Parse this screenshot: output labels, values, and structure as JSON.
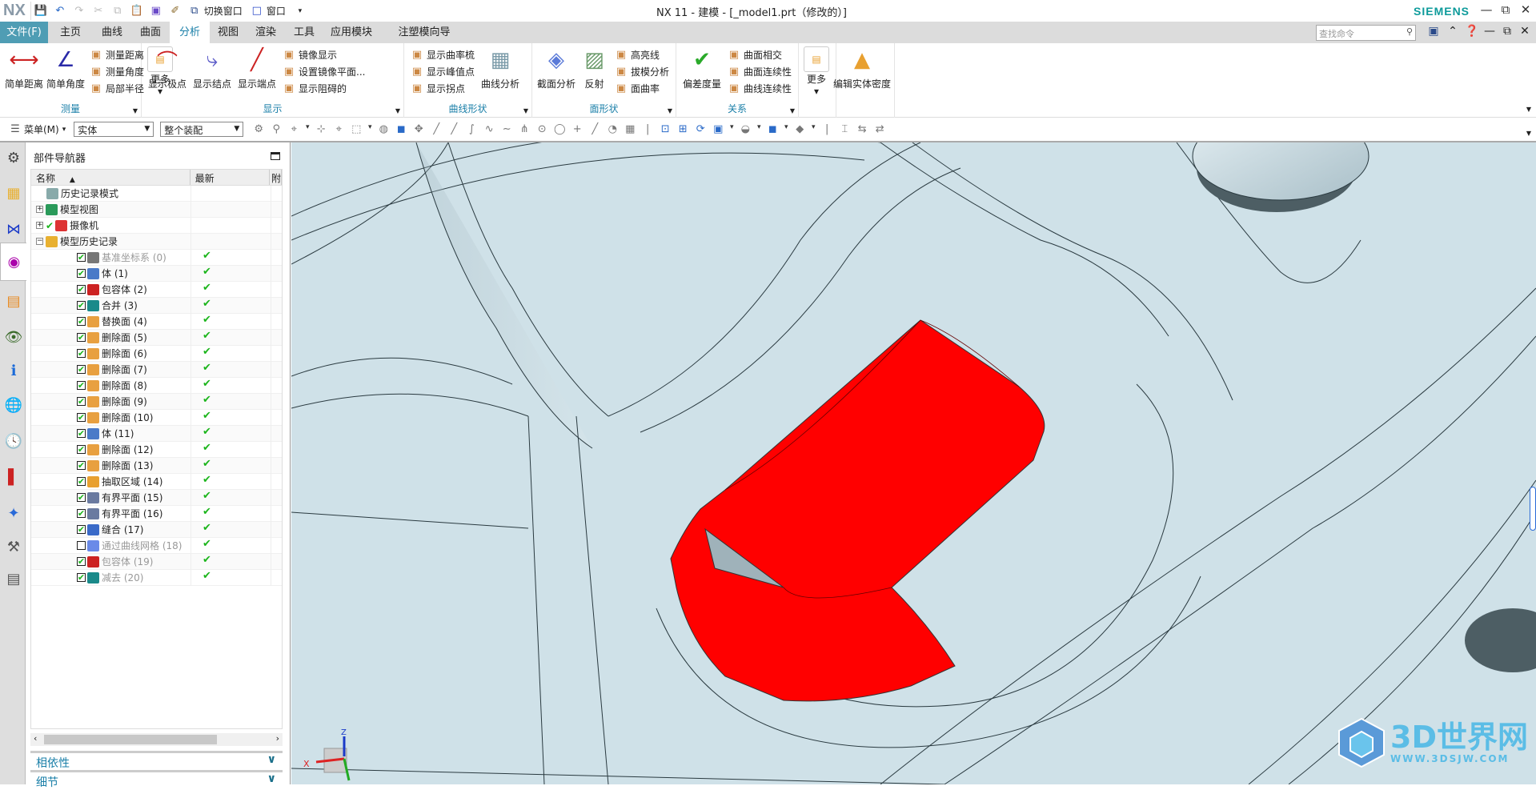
{
  "titlebar": {
    "logo": "NX",
    "switch_window": "切换窗口",
    "window_menu": "窗口",
    "title": "NX 11 - 建模 - [_model1.prt（修改的）]",
    "brand": "SIEMENS"
  },
  "tabs": [
    {
      "label": "文件(F)"
    },
    {
      "label": "主页"
    },
    {
      "label": "曲线"
    },
    {
      "label": "曲面"
    },
    {
      "label": "分析",
      "active": true
    },
    {
      "label": "视图"
    },
    {
      "label": "渲染"
    },
    {
      "label": "工具"
    },
    {
      "label": "应用模块"
    },
    {
      "label": "注塑模向导"
    }
  ],
  "search": {
    "placeholder": "查找命令"
  },
  "ribbon": {
    "groups": [
      {
        "label": "测量",
        "big": [
          {
            "label": "简单距离",
            "icon": "distance-icon"
          },
          {
            "label": "简单角度",
            "icon": "angle-icon"
          }
        ],
        "small": [
          [
            "测量距离",
            "测量角度",
            "局部半径"
          ]
        ],
        "more": "更多"
      },
      {
        "label": "显示",
        "big": [
          {
            "label": "显示极点",
            "icon": "poles-icon"
          },
          {
            "label": "显示结点",
            "icon": "knots-icon"
          },
          {
            "label": "显示端点",
            "icon": "endpoints-icon"
          }
        ],
        "small": [
          [
            "镜像显示",
            "设置镜像平面...",
            "显示阻碍的"
          ]
        ]
      },
      {
        "label": "曲线形状",
        "small": [
          [
            "显示曲率梳",
            "显示峰值点",
            "显示拐点"
          ]
        ],
        "big_after": [
          {
            "label": "曲线分析",
            "icon": "curve-analysis-icon"
          }
        ]
      },
      {
        "label": "面形状",
        "big": [
          {
            "label": "截面分析",
            "icon": "section-analysis-icon"
          },
          {
            "label": "反射",
            "icon": "reflection-icon"
          }
        ],
        "small": [
          [
            "高亮线",
            "拔模分析",
            "面曲率"
          ]
        ]
      },
      {
        "label": "关系",
        "big": [
          {
            "label": "偏差度量",
            "icon": "deviation-icon"
          }
        ],
        "small": [
          [
            "曲面相交",
            "曲面连续性",
            "曲线连续性"
          ]
        ]
      },
      {
        "label": "",
        "more": "更多"
      },
      {
        "label": "",
        "big": [
          {
            "label": "编辑实体密度",
            "icon": "density-icon"
          }
        ]
      }
    ]
  },
  "toolbar": {
    "menu": "菜单(M)",
    "type_filter": "实体",
    "scope_filter": "整个装配"
  },
  "navigator": {
    "title": "部件导航器",
    "columns": [
      "名称",
      "最新",
      "附"
    ],
    "rows": [
      {
        "label": "历史记录模式",
        "level": 0,
        "icon": "clock-icon",
        "color": "#8aa"
      },
      {
        "label": "模型视图",
        "level": 0,
        "expander": "+",
        "icon": "model-view-icon",
        "color": "#2a9a5a"
      },
      {
        "label": "摄像机",
        "level": 0,
        "expander": "+",
        "check": true,
        "icon": "camera-icon",
        "color": "#d33"
      },
      {
        "label": "模型历史记录",
        "level": 0,
        "expander": "−",
        "icon": "folder-icon",
        "color": "#e8b030"
      },
      {
        "label": "基准坐标系 (0)",
        "level": 1,
        "checked": true,
        "dim": true,
        "latest": true,
        "icon": "datum-csys-icon",
        "color": "#777"
      },
      {
        "label": "体 (1)",
        "level": 1,
        "checked": true,
        "latest": true,
        "icon": "body-icon",
        "color": "#4a7ac8"
      },
      {
        "label": "包容体 (2)",
        "level": 1,
        "checked": true,
        "latest": true,
        "icon": "bounding-body-icon",
        "color": "#c22"
      },
      {
        "label": "合并 (3)",
        "level": 1,
        "checked": true,
        "latest": true,
        "icon": "unite-icon",
        "color": "#1a8a8a"
      },
      {
        "label": "替换面 (4)",
        "level": 1,
        "checked": true,
        "latest": true,
        "icon": "replace-face-icon",
        "color": "#e8a040"
      },
      {
        "label": "删除面 (5)",
        "level": 1,
        "checked": true,
        "latest": true,
        "icon": "delete-face-icon",
        "color": "#e8a040"
      },
      {
        "label": "删除面 (6)",
        "level": 1,
        "checked": true,
        "latest": true,
        "icon": "delete-face-icon",
        "color": "#e8a040"
      },
      {
        "label": "删除面 (7)",
        "level": 1,
        "checked": true,
        "latest": true,
        "icon": "delete-face-icon",
        "color": "#e8a040"
      },
      {
        "label": "删除面 (8)",
        "level": 1,
        "checked": true,
        "latest": true,
        "icon": "delete-face-icon",
        "color": "#e8a040"
      },
      {
        "label": "删除面 (9)",
        "level": 1,
        "checked": true,
        "latest": true,
        "icon": "delete-face-icon",
        "color": "#e8a040"
      },
      {
        "label": "删除面 (10)",
        "level": 1,
        "checked": true,
        "latest": true,
        "icon": "delete-face-icon",
        "color": "#e8a040"
      },
      {
        "label": "体 (11)",
        "level": 1,
        "checked": true,
        "latest": true,
        "icon": "body-icon",
        "color": "#4a7ac8"
      },
      {
        "label": "删除面 (12)",
        "level": 1,
        "checked": true,
        "latest": true,
        "icon": "delete-face-icon",
        "color": "#e8a040"
      },
      {
        "label": "删除面 (13)",
        "level": 1,
        "checked": true,
        "latest": true,
        "icon": "delete-face-icon",
        "color": "#e8a040"
      },
      {
        "label": "抽取区域 (14)",
        "level": 1,
        "checked": true,
        "latest": true,
        "icon": "extract-region-icon",
        "color": "#e8a030"
      },
      {
        "label": "有界平面 (15)",
        "level": 1,
        "checked": true,
        "latest": true,
        "icon": "bounded-plane-icon",
        "color": "#6a7aa0"
      },
      {
        "label": "有界平面 (16)",
        "level": 1,
        "checked": true,
        "latest": true,
        "icon": "bounded-plane-icon",
        "color": "#6a7aa0"
      },
      {
        "label": "缝合 (17)",
        "level": 1,
        "checked": true,
        "latest": true,
        "icon": "sew-icon",
        "color": "#3a6ac8"
      },
      {
        "label": "通过曲线网格 (18)",
        "level": 1,
        "checked": false,
        "dim": true,
        "latest": true,
        "icon": "curve-mesh-icon",
        "color": "#6a8ae8"
      },
      {
        "label": "包容体 (19)",
        "level": 1,
        "checked": true,
        "dim": true,
        "latest": true,
        "icon": "bounding-body-icon",
        "color": "#c22"
      },
      {
        "label": "减去 (20)",
        "level": 1,
        "checked": true,
        "dim": true,
        "latest": true,
        "icon": "subtract-icon",
        "color": "#1a8a8a"
      }
    ],
    "sections": [
      "相依性",
      "细节"
    ]
  },
  "viewport": {
    "highlight_color": "#ff0000",
    "background_color": "#cfe1e8",
    "triad": {
      "x": "X",
      "z": "Z"
    }
  },
  "watermark": {
    "name": "3D世界网",
    "url": "WWW.3DSJW.COM"
  }
}
